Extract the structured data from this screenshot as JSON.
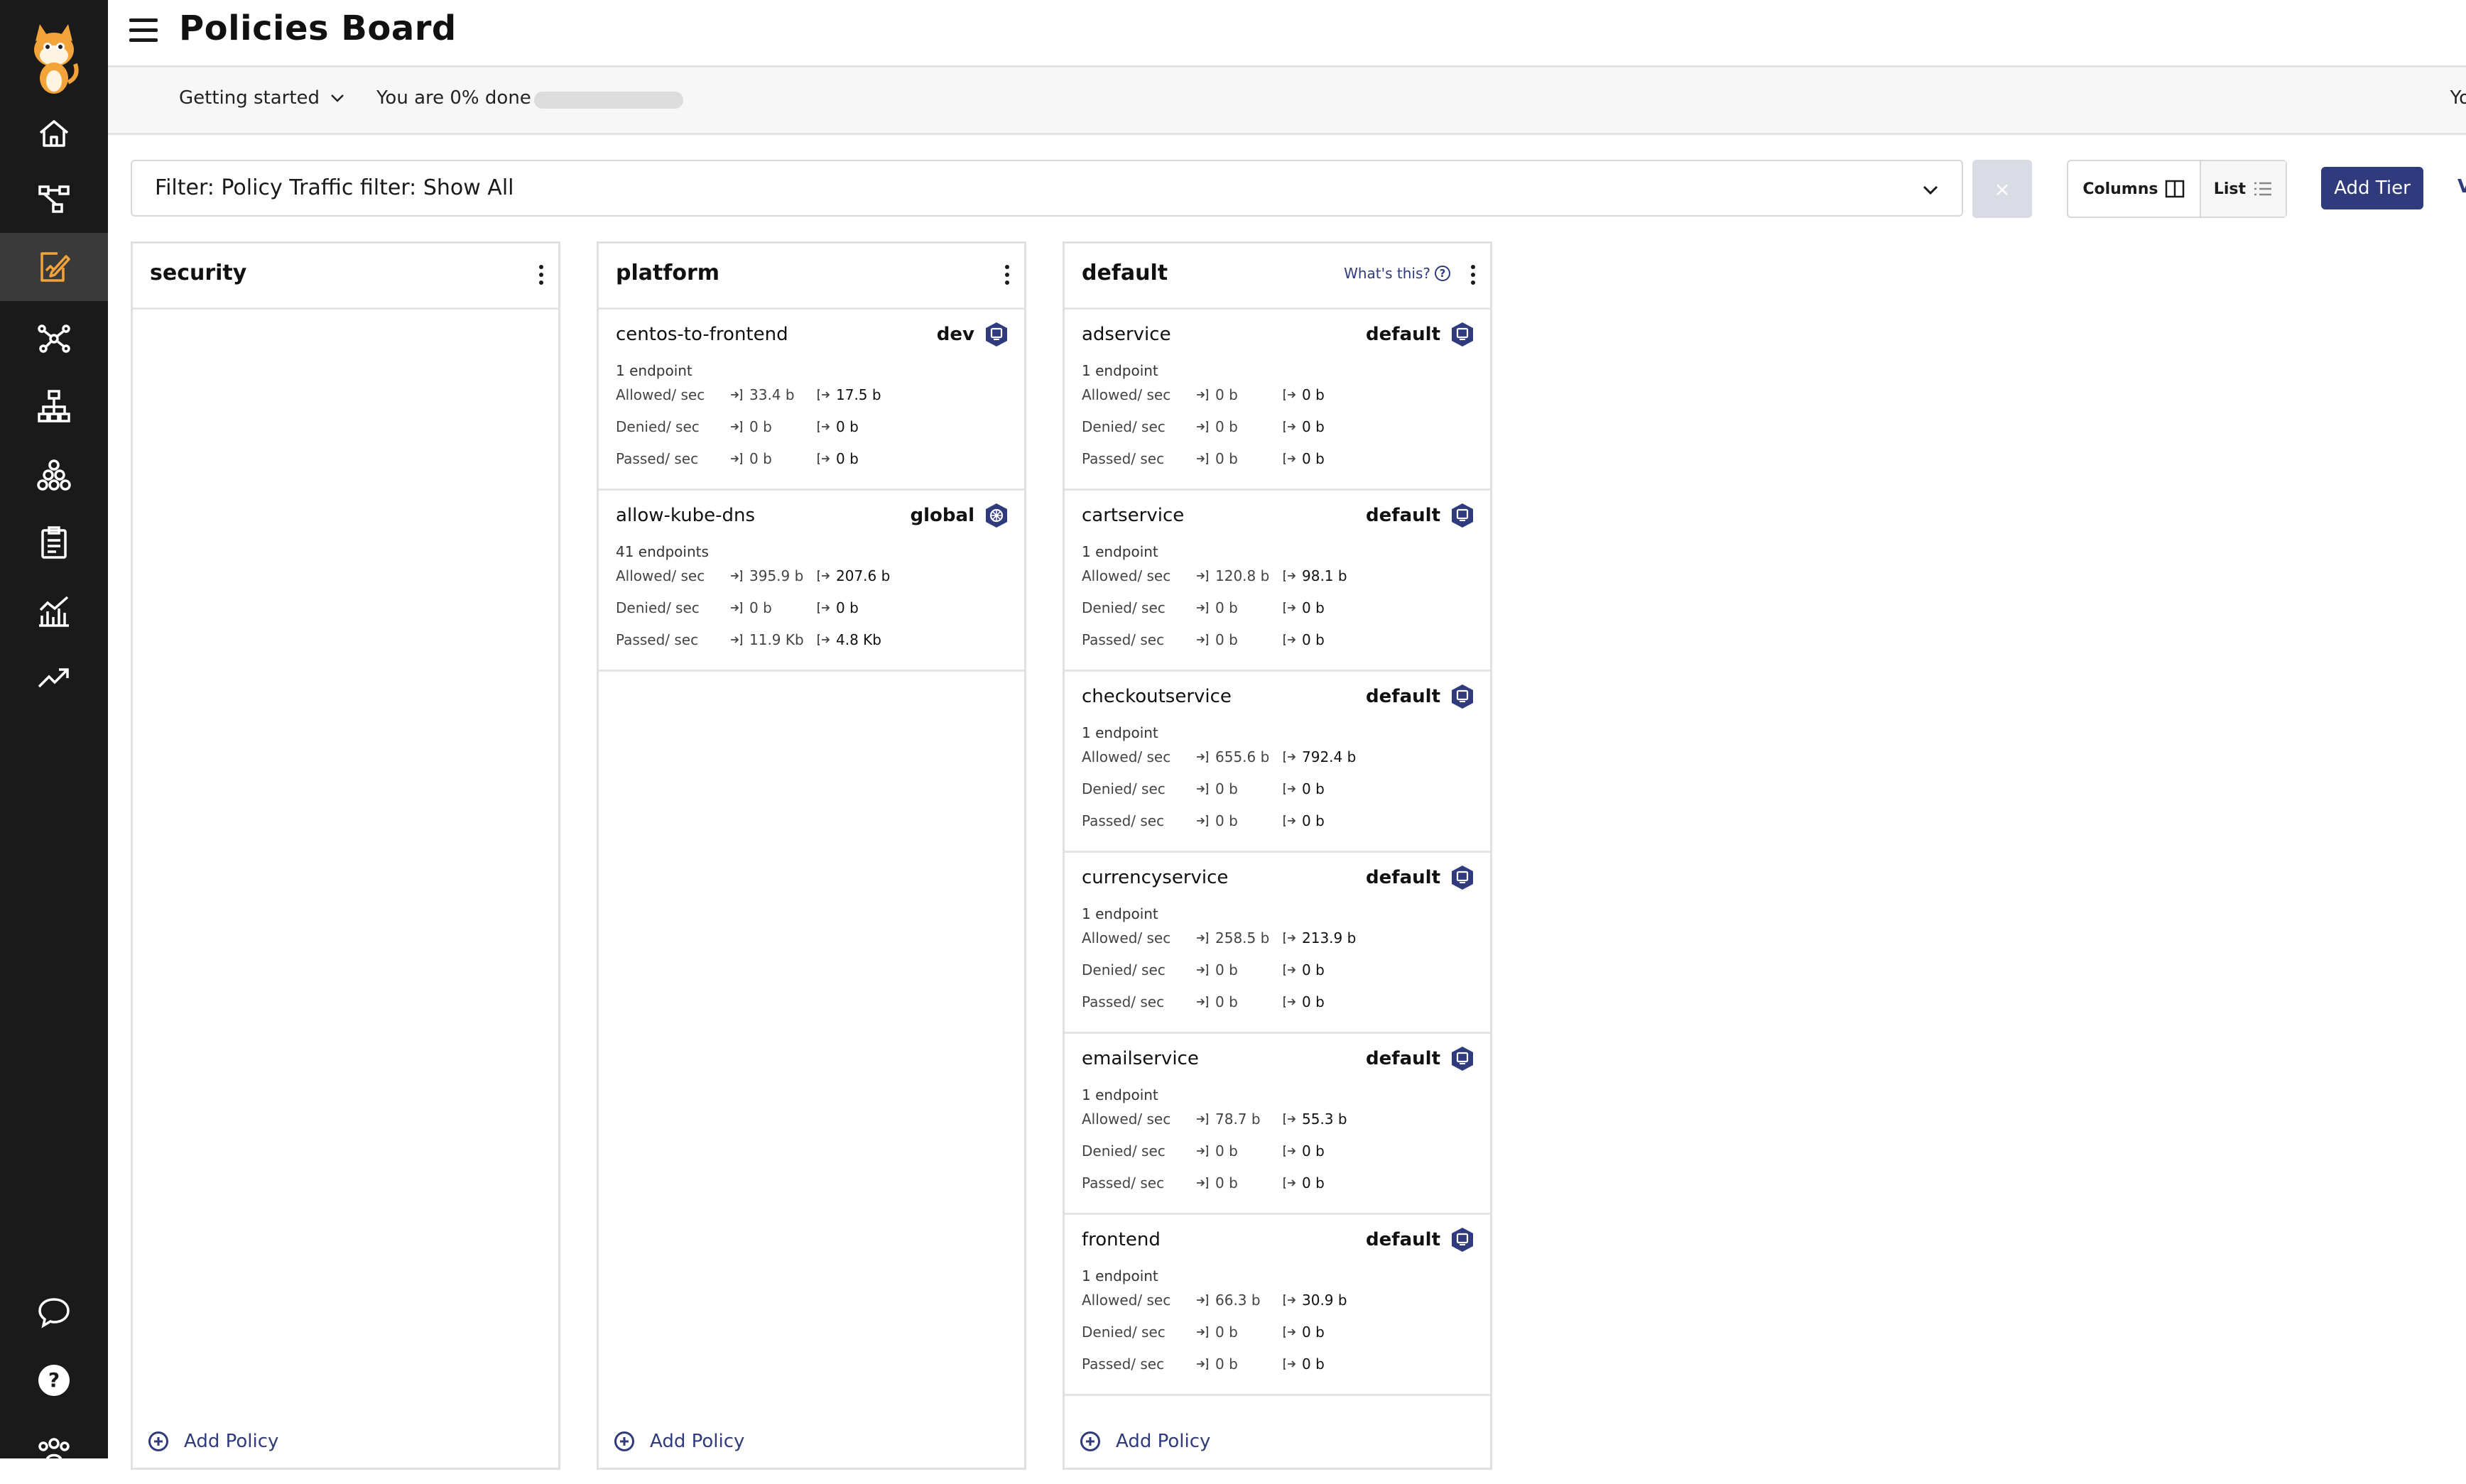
{
  "header": {
    "title": "Policies Board"
  },
  "getting_started": {
    "dropdown_label": "Getting started",
    "progress_text": "You are 0% done",
    "progress_percent": 0,
    "right_text": "Yo"
  },
  "toolbar": {
    "filter_text": "Filter: Policy Traffic filter: Show All",
    "clear_label": "×",
    "columns_label": "Columns",
    "list_label": "List",
    "add_tier_label": "Add Tier",
    "edge_text": "V"
  },
  "stat_labels": {
    "allowed": "Allowed/ sec",
    "denied": "Denied/ sec",
    "passed": "Passed/ sec"
  },
  "add_policy_label": "Add Policy",
  "tiers": [
    {
      "name": "security",
      "whats_this": "",
      "policies": []
    },
    {
      "name": "platform",
      "whats_this": "",
      "policies": [
        {
          "name": "centos-to-frontend",
          "namespace": "dev",
          "endpoints": "1 endpoint",
          "allowed_in": "33.4 b",
          "allowed_out": "17.5 b",
          "denied_in": "0 b",
          "denied_out": "0 b",
          "passed_in": "0 b",
          "passed_out": "0 b",
          "icon": "namespace-icon"
        },
        {
          "name": "allow-kube-dns",
          "namespace": "global",
          "endpoints": "41 endpoints",
          "allowed_in": "395.9 b",
          "allowed_out": "207.6 b",
          "denied_in": "0 b",
          "denied_out": "0 b",
          "passed_in": "11.9 Kb",
          "passed_out": "4.8 Kb",
          "icon": "global-icon"
        }
      ]
    },
    {
      "name": "default",
      "whats_this": "What's this?",
      "policies": [
        {
          "name": "adservice",
          "namespace": "default",
          "endpoints": "1 endpoint",
          "allowed_in": "0 b",
          "allowed_out": "0 b",
          "denied_in": "0 b",
          "denied_out": "0 b",
          "passed_in": "0 b",
          "passed_out": "0 b",
          "icon": "namespace-icon"
        },
        {
          "name": "cartservice",
          "namespace": "default",
          "endpoints": "1 endpoint",
          "allowed_in": "120.8 b",
          "allowed_out": "98.1 b",
          "denied_in": "0 b",
          "denied_out": "0 b",
          "passed_in": "0 b",
          "passed_out": "0 b",
          "icon": "namespace-icon"
        },
        {
          "name": "checkoutservice",
          "namespace": "default",
          "endpoints": "1 endpoint",
          "allowed_in": "655.6 b",
          "allowed_out": "792.4 b",
          "denied_in": "0 b",
          "denied_out": "0 b",
          "passed_in": "0 b",
          "passed_out": "0 b",
          "icon": "namespace-icon"
        },
        {
          "name": "currencyservice",
          "namespace": "default",
          "endpoints": "1 endpoint",
          "allowed_in": "258.5 b",
          "allowed_out": "213.9 b",
          "denied_in": "0 b",
          "denied_out": "0 b",
          "passed_in": "0 b",
          "passed_out": "0 b",
          "icon": "namespace-icon"
        },
        {
          "name": "emailservice",
          "namespace": "default",
          "endpoints": "1 endpoint",
          "allowed_in": "78.7 b",
          "allowed_out": "55.3 b",
          "denied_in": "0 b",
          "denied_out": "0 b",
          "passed_in": "0 b",
          "passed_out": "0 b",
          "icon": "namespace-icon"
        },
        {
          "name": "frontend",
          "namespace": "default",
          "endpoints": "1 endpoint",
          "allowed_in": "66.3 b",
          "allowed_out": "30.9 b",
          "denied_in": "0 b",
          "denied_out": "0 b",
          "passed_in": "0 b",
          "passed_out": "0 b",
          "icon": "namespace-icon"
        }
      ]
    }
  ],
  "sidebar": {
    "items": [
      {
        "icon": "home-icon"
      },
      {
        "icon": "service-graph-icon"
      },
      {
        "icon": "policies-icon",
        "active": true
      },
      {
        "icon": "network-icon"
      },
      {
        "icon": "hierarchy-icon"
      },
      {
        "icon": "endpoints-icon"
      },
      {
        "icon": "clipboard-icon"
      },
      {
        "icon": "dashboard-chart-icon"
      },
      {
        "icon": "trend-icon"
      }
    ],
    "bottom": [
      {
        "icon": "chat-icon"
      },
      {
        "icon": "help-icon"
      },
      {
        "icon": "team-icon"
      }
    ],
    "colors": {
      "background": "#1a1a1a",
      "active": "#3a3a3a",
      "accent": "#f2a33a"
    }
  },
  "colors": {
    "brand": "#2f3b7c",
    "border": "#e0e0e0"
  }
}
